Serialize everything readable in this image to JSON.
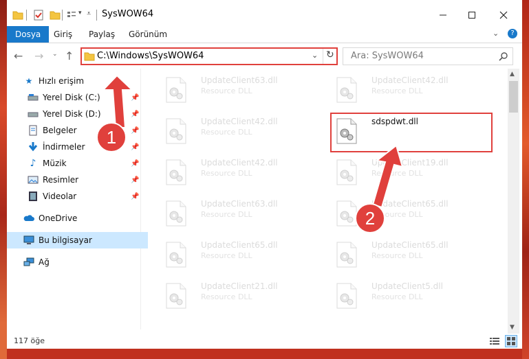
{
  "window": {
    "title": "SysWOW64"
  },
  "ribbon": {
    "tabs": [
      {
        "label": "Dosya",
        "active": true
      },
      {
        "label": "Giriş",
        "active": false
      },
      {
        "label": "Paylaş",
        "active": false
      },
      {
        "label": "Görünüm",
        "active": false
      }
    ]
  },
  "address": {
    "path": "C:\\Windows\\SysWOW64"
  },
  "search": {
    "placeholder": "Ara: SysWOW64"
  },
  "sidebar": {
    "items": [
      {
        "label": "Hızlı erişim",
        "icon": "star-icon"
      },
      {
        "label": "Yerel Disk (C:)",
        "icon": "drive-icon"
      },
      {
        "label": "Yerel Disk (D:)",
        "icon": "drive-icon"
      },
      {
        "label": "Belgeler",
        "icon": "documents-icon"
      },
      {
        "label": "İndirmeler",
        "icon": "download-icon"
      },
      {
        "label": "Müzik",
        "icon": "music-icon"
      },
      {
        "label": "Resimler",
        "icon": "pictures-icon"
      },
      {
        "label": "Videolar",
        "icon": "video-icon"
      },
      {
        "label": "OneDrive",
        "icon": "cloud-icon"
      },
      {
        "label": "Bu bilgisayar",
        "icon": "computer-icon"
      },
      {
        "label": "Ağ",
        "icon": "network-icon"
      }
    ]
  },
  "files": [
    {
      "name": "UpdateClient63.dll",
      "type": "Resource DLL"
    },
    {
      "name": "UpdateClient42.dll",
      "type": "Resource DLL"
    },
    {
      "name": "UpdateClient42.dll",
      "type": "Resource DLL"
    },
    {
      "name": "sdspdwt.dll",
      "type": ""
    },
    {
      "name": "UpdateClient42.dll",
      "type": "Resource DLL"
    },
    {
      "name": "UpdateClient19.dll",
      "type": "Resource DLL"
    },
    {
      "name": "UpdateClient63.dll",
      "type": "Resource DLL"
    },
    {
      "name": "UpdateClient65.dll",
      "type": "Resource DLL"
    },
    {
      "name": "UpdateClient65.dll",
      "type": "Resource DLL"
    },
    {
      "name": "UpdateClient65.dll",
      "type": "Resource DLL"
    },
    {
      "name": "UpdateClient21.dll",
      "type": "Resource DLL"
    },
    {
      "name": "UpdateClient5.dll",
      "type": "Resource DLL"
    }
  ],
  "status": {
    "count": "117 öğe"
  },
  "annotations": {
    "step1": "1",
    "step2": "2",
    "color": "#e0403c"
  }
}
